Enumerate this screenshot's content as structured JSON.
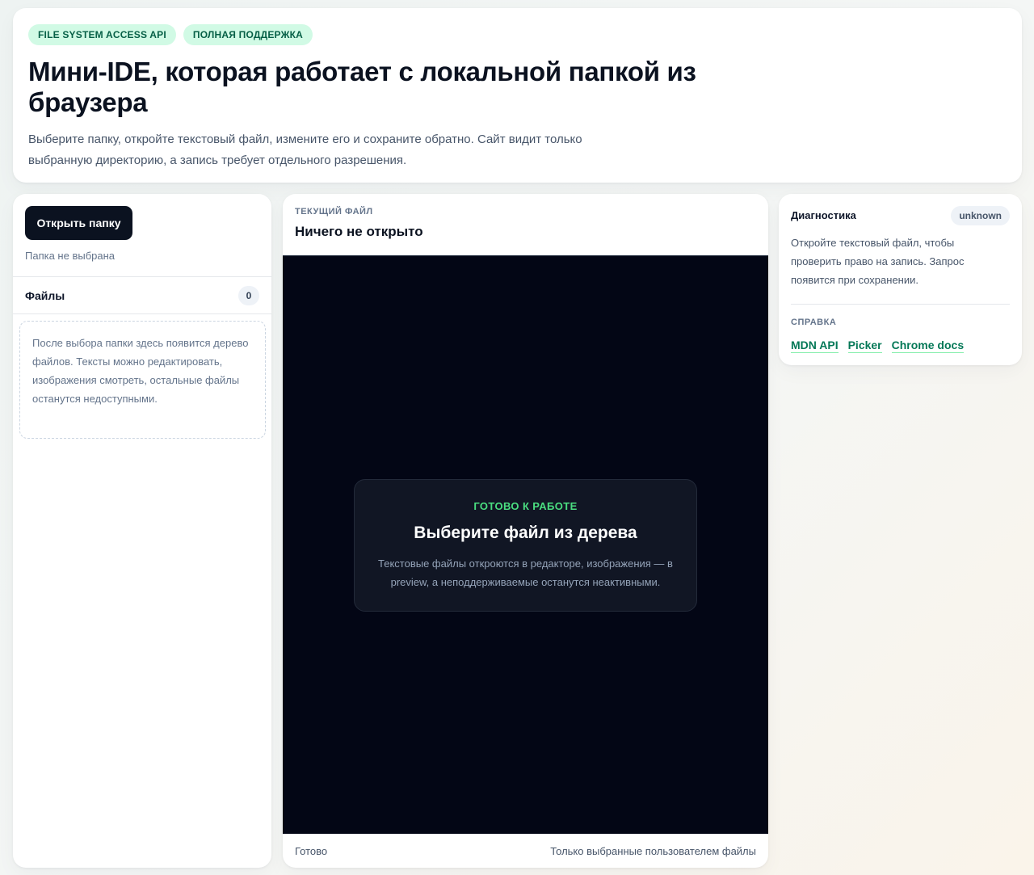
{
  "hero": {
    "badges": [
      "FILE SYSTEM ACCESS API",
      "ПОЛНАЯ ПОДДЕРЖКА"
    ],
    "title": "Мини-IDE, которая работает с локальной папкой из браузера",
    "description": "Выберите папку, откройте текстовый файл, измените его и сохраните обратно. Сайт видит только выбранную директорию, а запись требует отдельного разрешения."
  },
  "sidebar": {
    "open_button": "Открыть папку",
    "folder_status": "Папка не выбрана",
    "files_title": "Файлы",
    "files_count": "0",
    "empty_text": "После выбора папки здесь появится дерево файлов. Тексты можно редактировать, изображения смотреть, остальные файлы останутся недоступными."
  },
  "editor": {
    "current_label": "ТЕКУЩИЙ ФАЙЛ",
    "current_name": "Ничего не открыто",
    "ready_tag": "ГОТОВО К РАБОТЕ",
    "ready_title": "Выберите файл из дерева",
    "ready_text": "Текстовые файлы откроются в редакторе, изображения — в preview, а неподдерживаемые останутся неактивными.",
    "status_left": "Готово",
    "status_right": "Только выбранные пользователем файлы"
  },
  "diagnostics": {
    "title": "Диагностика",
    "badge": "unknown",
    "text": "Откройте текстовый файл, чтобы проверить право на запись. Запрос появится при сохранении.",
    "help_label": "СПРАВКА",
    "links": [
      "MDN API",
      "Picker",
      "Chrome docs"
    ]
  }
}
